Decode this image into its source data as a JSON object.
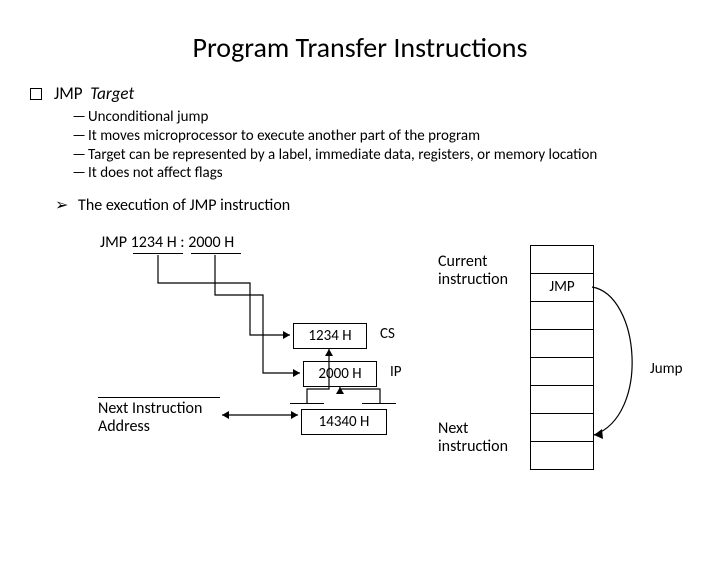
{
  "title": "Program Transfer Instructions",
  "topic": {
    "mnemonic": "JMP",
    "operand": "Target"
  },
  "points": [
    "Unconditional jump",
    "It moves microprocessor to execute another part of the program",
    "Target can be represented by a label, immediate data, registers, or memory location",
    "It does not affect flags"
  ],
  "execution_heading": "The execution of JMP instruction",
  "diagram": {
    "jmp_line": "JMP  1234 H : 2000 H",
    "cs_value": "1234 H",
    "ip_value": "2000 H",
    "cs_label": "CS",
    "ip_label": "IP",
    "addr_value": "14340 H",
    "next_addr": "Next Instruction Address",
    "current": "Current instruction",
    "next": "Next instruction",
    "jmp_cell": "JMP",
    "jump_label": "Jump"
  }
}
